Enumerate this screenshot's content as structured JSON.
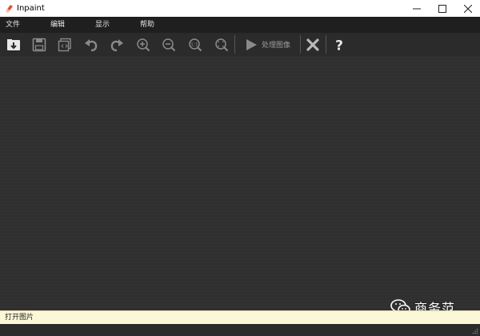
{
  "window": {
    "title": "Inpaint"
  },
  "menu": {
    "items": [
      {
        "label": "文件"
      },
      {
        "label": "编辑"
      },
      {
        "label": "显示"
      },
      {
        "label": "帮助"
      }
    ]
  },
  "toolbar": {
    "process_label": "处理图像",
    "icons": [
      "open-icon",
      "save-icon",
      "save-as-icon",
      "undo-icon",
      "redo-icon",
      "zoom-in-icon",
      "zoom-out-icon",
      "actual-size-icon",
      "fit-window-icon",
      "play-icon",
      "clear-icon",
      "help-icon"
    ]
  },
  "status": {
    "text": "打开图片"
  },
  "watermark": {
    "text": "商务范"
  },
  "colors": {
    "menubar": "#1f1f1f",
    "toolbar": "#2b2b2b",
    "canvas": "#2f2f2f",
    "statusbar": "#fcf7d7"
  }
}
